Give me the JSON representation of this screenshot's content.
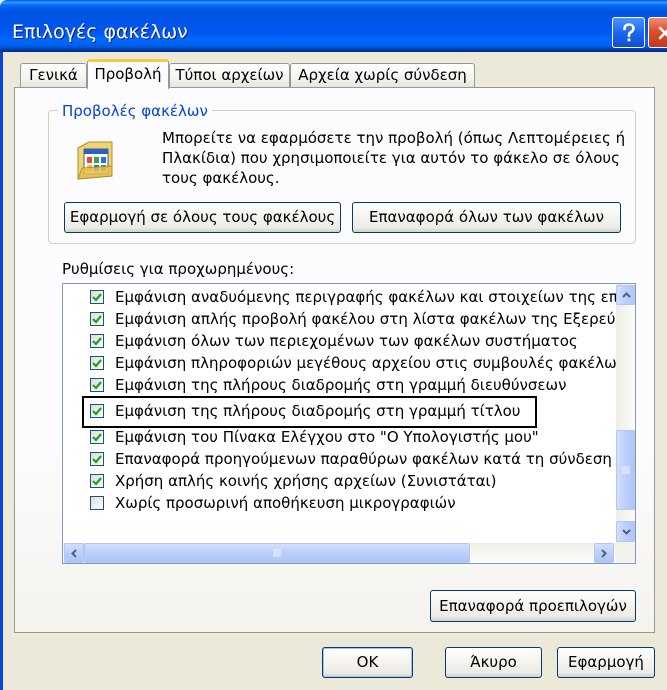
{
  "window": {
    "title": "Επιλογές φακέλων"
  },
  "tabs": [
    {
      "label": "Γενικά",
      "selected": false
    },
    {
      "label": "Προβολή",
      "selected": true
    },
    {
      "label": "Τύποι αρχείων",
      "selected": false
    },
    {
      "label": "Αρχεία χωρίς σύνδεση",
      "selected": false
    }
  ],
  "folder_views": {
    "legend": "Προβολές φακέλων",
    "description_lines": [
      "Μπορείτε να εφαρμόσετε την προβολή (όπως Λεπτομέρειες ή",
      "Πλακίδια) που χρησιμοποιείτε για αυτόν το φάκελο σε όλους",
      "τους φακέλους."
    ],
    "apply_all_label": "Εφαρμογή σε όλους τους φακέλους",
    "reset_all_label": "Επαναφορά όλων των φακέλων"
  },
  "advanced": {
    "label": "Ρυθμίσεις για προχωρημένους:",
    "items": [
      {
        "label": "Εμφάνιση αναδυόμενης περιγραφής φακέλων και στοιχείων της επ",
        "checked": true
      },
      {
        "label": "Εμφάνιση απλής προβολή φακέλου στη λίστα φακέλων της Εξερεύν",
        "checked": true
      },
      {
        "label": "Εμφάνιση όλων των περιεχομένων των φακέλων συστήματος",
        "checked": true
      },
      {
        "label": "Εμφάνιση πληροφοριών μεγέθους αρχείου στις συμβουλές φακέλω",
        "checked": true
      },
      {
        "label": "Εμφάνιση της πλήρους διαδρομής στη γραμμή διευθύνσεων",
        "checked": true
      },
      {
        "label": "Εμφάνιση της πλήρους διαδρομής στη γραμμή τίτλου",
        "checked": true,
        "highlighted": true
      },
      {
        "label": "Εμφάνιση του Πίνακα Ελέγχου στο \"Ο Υπολογιστής μου\"",
        "checked": true
      },
      {
        "label": "Επαναφορά προηγούμενων παραθύρων φακέλων κατά τη σύνδεση",
        "checked": true
      },
      {
        "label": "Χρήση απλής κοινής χρήσης αρχείων (Συνιστάται)",
        "checked": true
      },
      {
        "label": "Χωρίς προσωρινή αποθήκευση μικρογραφιών",
        "checked": false
      }
    ],
    "restore_defaults_label": "Επαναφορά προεπιλογών"
  },
  "footer": {
    "ok_label": "OK",
    "cancel_label": "Άκυρο",
    "apply_label": "Εφαρμογή"
  },
  "icons": {
    "help": "help-icon",
    "close": "close-icon",
    "folder_views": "folder-views-icon",
    "checkmark": "checkmark-icon",
    "scroll_up": "chevron-up-icon",
    "scroll_down": "chevron-down-icon",
    "scroll_left": "chevron-left-icon",
    "scroll_right": "chevron-right-icon",
    "scroll_grip": "grip-icon"
  },
  "colors": {
    "dialog_background": "#ECE9D8",
    "title_bar": "#0054E3",
    "group_label": "#0046D5",
    "selected_tab_accent": "#FFC83C",
    "checkmark": "#21A121",
    "close_button": "#DC4E2C",
    "highlight_box": "#000000"
  }
}
